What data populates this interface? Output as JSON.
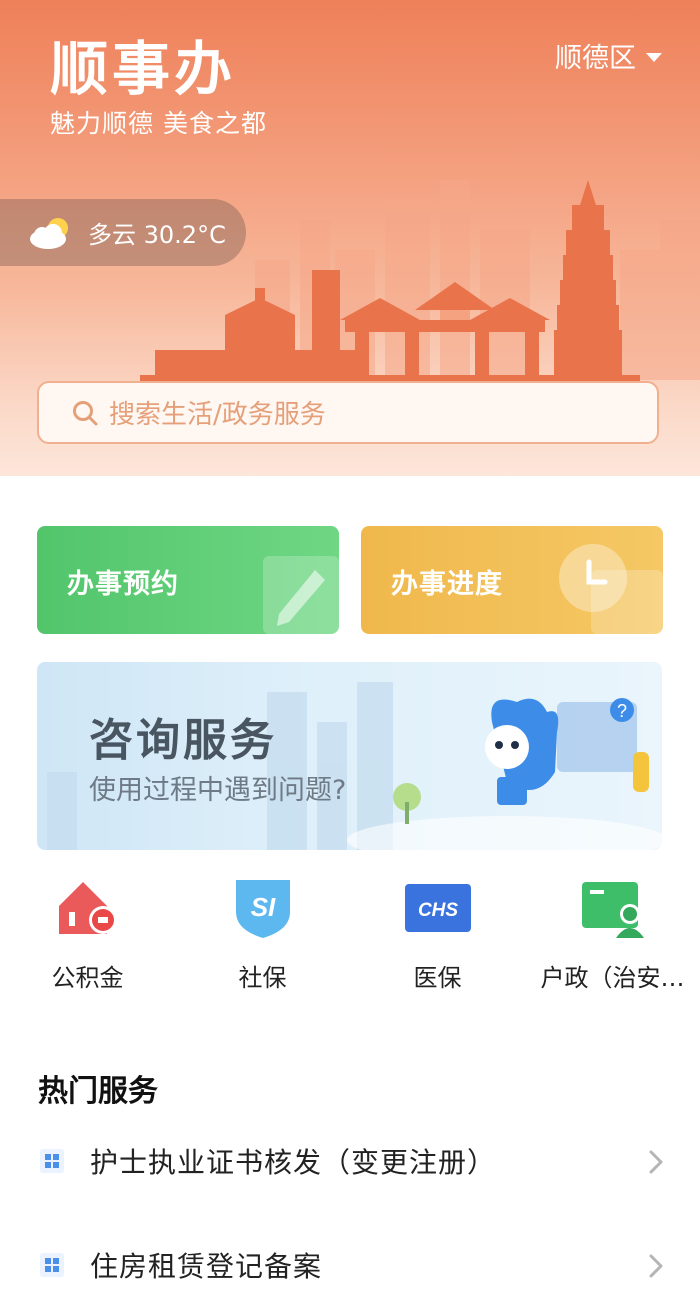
{
  "header": {
    "app_title": "顺事办",
    "slogan": "魅力顺德 美食之都",
    "region": "顺德区"
  },
  "weather": {
    "text": "多云 30.2°C",
    "icon": "partly-cloudy-icon"
  },
  "search": {
    "placeholder": "搜索生活/政务服务",
    "icon": "search-icon"
  },
  "quick_actions": [
    {
      "label": "办事预约",
      "icon": "pencil-icon",
      "color": "#5ccd75"
    },
    {
      "label": "办事进度",
      "icon": "clock-icon",
      "color": "#f2bf58"
    }
  ],
  "banner": {
    "title": "咨询服务",
    "subtitle": "使用过程中遇到问题?",
    "icon_text": "?"
  },
  "services": [
    {
      "label": "公积金",
      "icon": "housing-fund-icon"
    },
    {
      "label": "社保",
      "icon": "social-security-icon",
      "badge": "SI"
    },
    {
      "label": "医保",
      "icon": "medical-insurance-icon",
      "badge": "CHS"
    },
    {
      "label": "户政（治安…",
      "icon": "household-id-icon"
    }
  ],
  "hot_services": {
    "title": "热门服务",
    "items": [
      {
        "label": "护士执业证书核发（变更注册）",
        "icon": "service-grid-icon"
      },
      {
        "label": "住房租赁登记备案",
        "icon": "service-grid-icon"
      }
    ]
  },
  "colors": {
    "hero_top": "#ee8059",
    "search_border": "#f0b08f",
    "green": "#5ccd75",
    "yellow": "#f2bf58",
    "accent_blue": "#3d8de8"
  }
}
